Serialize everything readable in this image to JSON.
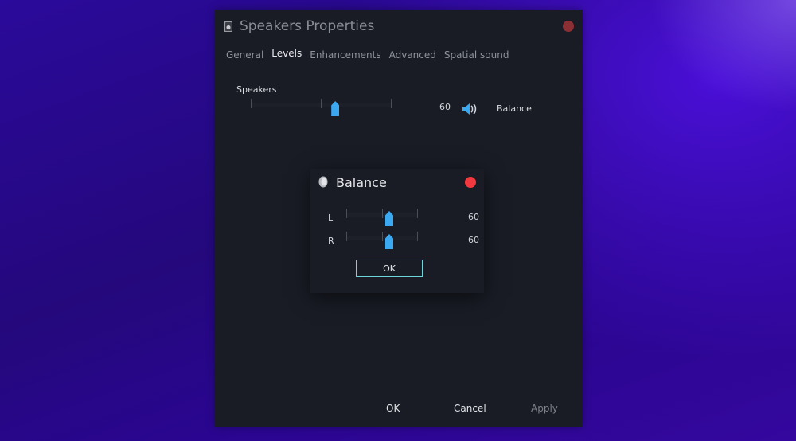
{
  "window": {
    "title": "Speakers Properties",
    "icon": "speaker-device-icon",
    "close_icon": "close-icon",
    "close_color": "#8c2f35"
  },
  "tabs": [
    {
      "label": "General",
      "active": false
    },
    {
      "label": "Levels",
      "active": true
    },
    {
      "label": "Enhancements",
      "active": false
    },
    {
      "label": "Advanced",
      "active": false
    },
    {
      "label": "Spatial sound",
      "active": false
    }
  ],
  "levels": {
    "device_label": "Speakers",
    "volume_value": "60",
    "volume_fraction": 0.6,
    "mute_icon": "speaker-volume-icon",
    "balance_label": "Balance"
  },
  "footer": {
    "ok_label": "OK",
    "cancel_label": "Cancel",
    "apply_label": "Apply",
    "apply_disabled": true
  },
  "balance_dialog": {
    "title": "Balance",
    "icon": "speaker-icon",
    "close_icon": "close-icon",
    "close_color": "#f2393f",
    "channels": [
      {
        "label": "L",
        "value": "60",
        "fraction": 0.6
      },
      {
        "label": "R",
        "value": "60",
        "fraction": 0.6
      }
    ],
    "ok_label": "OK"
  },
  "colors": {
    "accent": "#3aa9f2",
    "ok_border": "#6fd4dc",
    "window_bg": "#191c25"
  }
}
